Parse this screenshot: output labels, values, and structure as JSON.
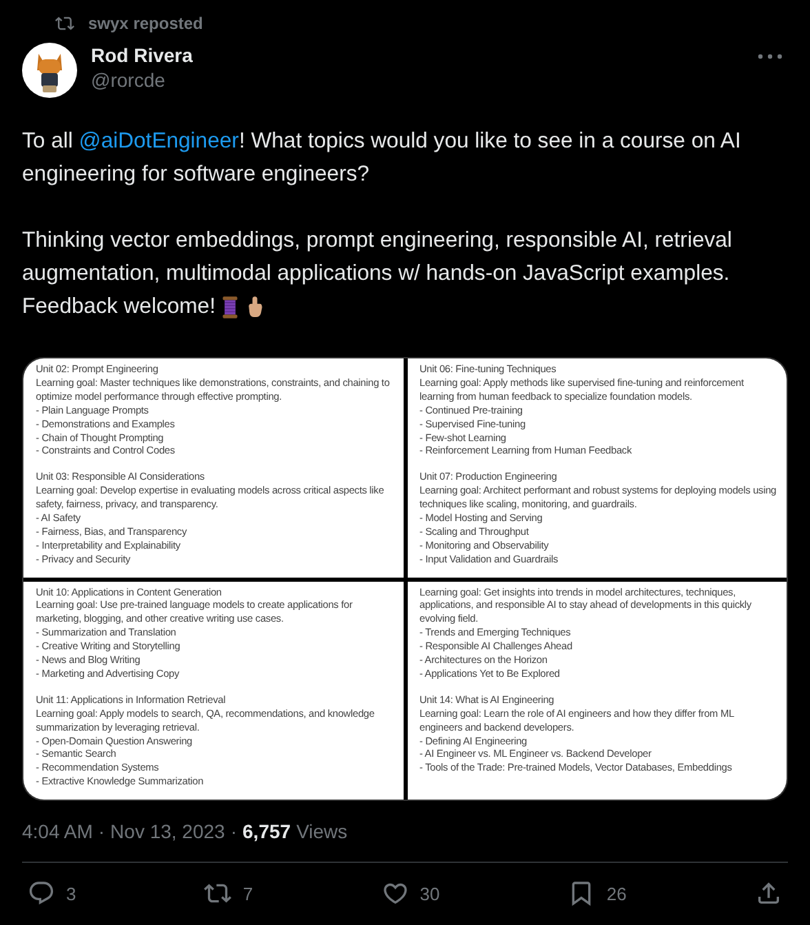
{
  "repost": {
    "label": "swyx reposted"
  },
  "author": {
    "name": "Rod Rivera",
    "handle": "@rorcde"
  },
  "body": {
    "intro_start": "To all",
    "mention": "@aiDotEngineer",
    "intro_rest": "! What topics would you like to see in a course on AI engineering for software engineers?",
    "line_2": "Thinking vector embeddings, prompt engineering, responsible AI, retrieval augmentation, multimodal applications w/ hands-on JavaScript examples.",
    "line_3": "Feedback welcome!"
  },
  "document": {
    "panels": [
      {
        "blocks": [
          {
            "title": "Unit 02: Prompt Engineering",
            "goal": "Learning goal: Master techniques like demonstrations, constraints, and chaining to optimize model performance through effective prompting.",
            "items": [
              "- Plain Language Prompts",
              "- Demonstrations and Examples",
              "- Chain of Thought Prompting",
              "- Constraints and Control Codes"
            ]
          },
          {
            "title": "Unit 03: Responsible AI Considerations",
            "goal": "Learning goal: Develop expertise in evaluating models across critical aspects like safety, fairness, privacy, and transparency.",
            "items": [
              "- AI Safety",
              "- Fairness, Bias, and Transparency",
              "- Interpretability and Explainability",
              "- Privacy and Security"
            ]
          }
        ]
      },
      {
        "blocks": [
          {
            "title": "Unit 06: Fine-tuning Techniques",
            "goal": "Learning goal: Apply methods like supervised fine-tuning and reinforcement learning from human feedback to specialize foundation models.",
            "items": [
              "- Continued Pre-training",
              "- Supervised Fine-tuning",
              "- Few-shot Learning",
              "- Reinforcement Learning from Human Feedback"
            ]
          },
          {
            "title": "Unit 07: Production Engineering",
            "goal": "Learning goal: Architect performant and robust systems for deploying models using techniques like scaling, monitoring, and guardrails.",
            "items": [
              "- Model Hosting and Serving",
              "- Scaling and Throughput",
              "- Monitoring and Observability",
              "- Input Validation and Guardrails"
            ]
          }
        ]
      },
      {
        "blocks": [
          {
            "title": "Unit 10: Applications in Content Generation",
            "goal": "Learning goal: Use pre-trained language models to create applications for marketing, blogging, and other creative writing use cases.",
            "items": [
              "- Summarization and Translation",
              "- Creative Writing and Storytelling",
              "- News and Blog Writing",
              "- Marketing and Advertising Copy"
            ]
          },
          {
            "title": "Unit 11: Applications in Information Retrieval",
            "goal": "Learning goal: Apply models to search, QA, recommendations, and knowledge summarization by leveraging retrieval.",
            "items": [
              "- Open-Domain Question Answering",
              "- Semantic Search",
              "- Recommendation Systems",
              "- Extractive Knowledge Summarization"
            ]
          }
        ]
      },
      {
        "blocks": [
          {
            "goal": "Learning goal: Get insights into trends in model architectures, techniques, applications, and responsible AI to stay ahead of developments in this quickly evolving field.",
            "items": [
              "- Trends and Emerging Techniques",
              "- Responsible AI Challenges Ahead",
              "- Architectures on the Horizon",
              "- Applications Yet to Be Explored"
            ]
          },
          {
            "title": "Unit 14: What is AI Engineering",
            "goal": "Learning goal: Learn the role of AI engineers and how they differ from ML engineers and backend developers.",
            "items": [
              "- Defining AI Engineering",
              "- AI Engineer vs. ML Engineer vs. Backend Developer",
              "- Tools of the Trade: Pre-trained Models, Vector Databases, Embeddings"
            ]
          }
        ]
      }
    ]
  },
  "meta": {
    "time": "4:04 AM",
    "separator_1": "·",
    "date": "Nov 13, 2023",
    "separator_2": "·",
    "views_count": "6,757",
    "views_label": "Views"
  },
  "actions": [
    {
      "kind": "reply",
      "count": "3"
    },
    {
      "kind": "repost",
      "count": "7"
    },
    {
      "kind": "like",
      "count": "30"
    },
    {
      "kind": "bookmark",
      "count": "26"
    },
    {
      "kind": "share"
    }
  ]
}
